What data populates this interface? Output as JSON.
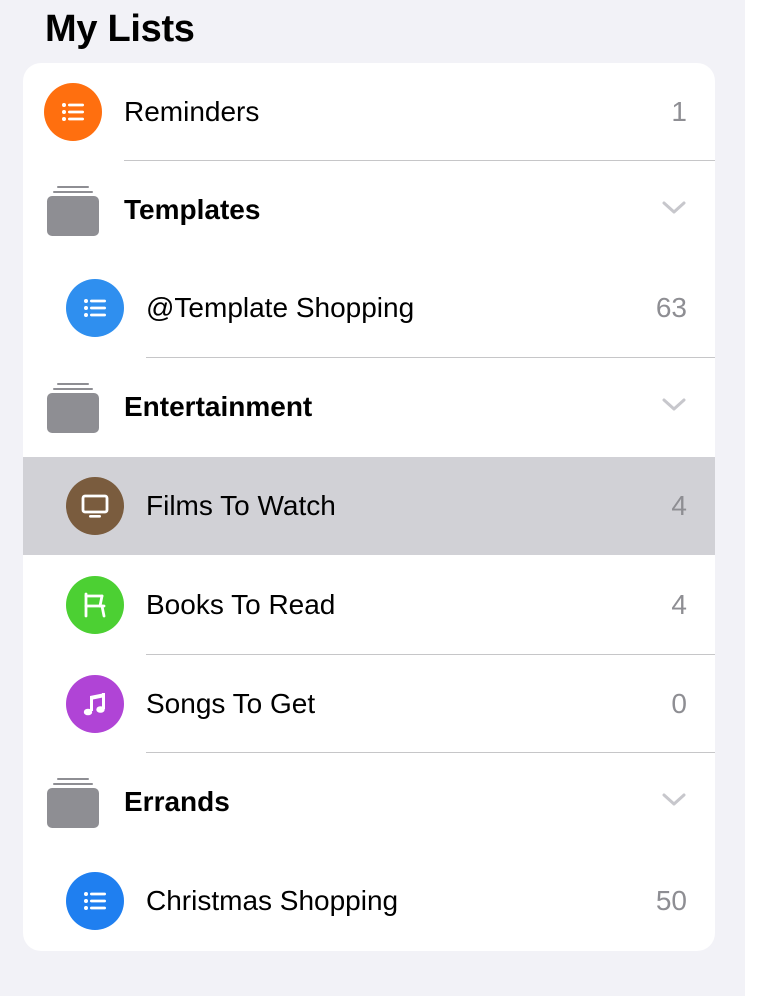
{
  "section_title": "My Lists",
  "colors": {
    "orange": "#ff6f0f",
    "blue_light": "#2f8fef",
    "blue": "#1f7ff0",
    "brown": "#7a5c3e",
    "green": "#4cd033",
    "purple": "#b044d6",
    "folder": "#8e8e93",
    "selected_row": "#d1d1d6"
  },
  "rows": [
    {
      "type": "list",
      "label": "Reminders",
      "count": "1",
      "icon": "list-bullet-icon",
      "color": "orange"
    },
    {
      "type": "group",
      "label": "Templates",
      "icon": "folder-icon",
      "chevron": "chevron-down-icon"
    },
    {
      "type": "list",
      "label": "@Template Shopping",
      "count": "63",
      "icon": "list-bullet-icon",
      "color": "blue_light"
    },
    {
      "type": "group",
      "label": "Entertainment",
      "icon": "folder-icon",
      "chevron": "chevron-down-icon"
    },
    {
      "type": "list",
      "label": "Films To Watch",
      "count": "4",
      "icon": "tv-icon",
      "color": "brown",
      "selected": true
    },
    {
      "type": "list",
      "label": "Books To Read",
      "count": "4",
      "icon": "chair-icon",
      "color": "green"
    },
    {
      "type": "list",
      "label": "Songs To Get",
      "count": "0",
      "icon": "music-note-icon",
      "color": "purple"
    },
    {
      "type": "group",
      "label": "Errands",
      "icon": "folder-icon",
      "chevron": "chevron-down-icon"
    },
    {
      "type": "list",
      "label": "Christmas Shopping",
      "count": "50",
      "icon": "list-bullet-icon",
      "color": "blue"
    }
  ]
}
